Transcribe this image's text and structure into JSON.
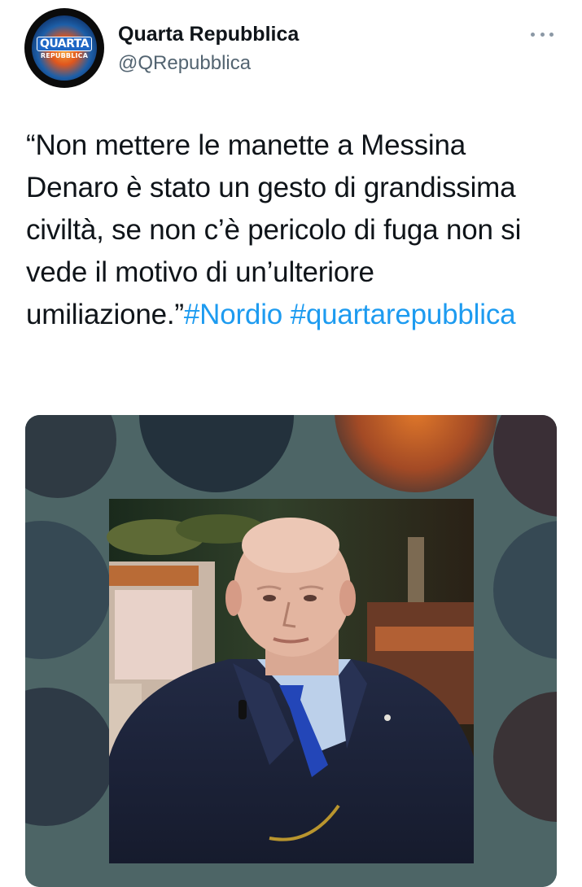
{
  "tweet": {
    "author": {
      "display_name": "Quarta Repubblica",
      "handle": "@QRepubblica",
      "avatar_logo_line1": "QUARTA",
      "avatar_logo_line2": "REPUBBLICA"
    },
    "text_quote": "“Non mettere le manette a Messina Denaro è stato un gesto di grandissima civiltà, se non c’è pericolo di fuga non si vede il motivo di un’ulteriore umiliazione.”",
    "hashtags": [
      "#Nordio",
      "#quartarepubblica"
    ],
    "more_icon": "ellipsis-icon",
    "media": {
      "type": "photo",
      "background_color": "#4d6566"
    }
  },
  "colors": {
    "link": "#1d9bf0",
    "text": "#0f1419",
    "secondary": "#536471"
  }
}
